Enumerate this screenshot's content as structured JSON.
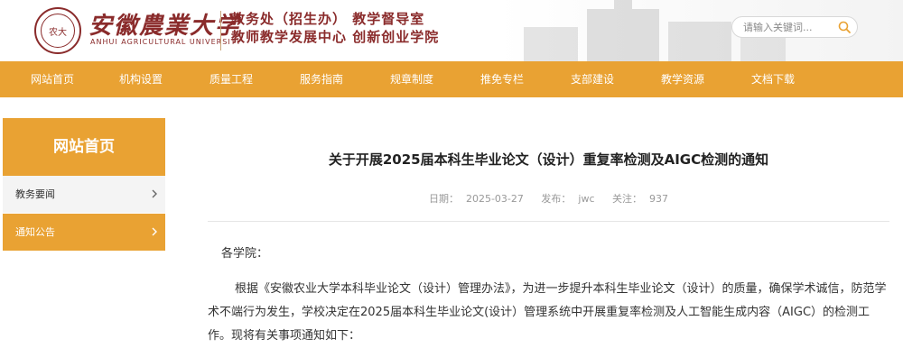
{
  "header": {
    "logo_text": "农大",
    "university_name": "安徽農業大学",
    "university_name_en": "ANHUI AGRICULTURAL UNIVERSITY",
    "dept_line1": "教务处（招生办） 教学督导室",
    "dept_line2": "教师教学发展中心 创新创业学院",
    "search_placeholder": "请输入关键词...",
    "search_icon": "search-icon"
  },
  "nav": {
    "items": [
      "网站首页",
      "机构设置",
      "质量工程",
      "服务指南",
      "规章制度",
      "推免专栏",
      "支部建设",
      "教学资源",
      "文档下载"
    ]
  },
  "sidebar": {
    "title": "网站首页",
    "items": [
      {
        "label": "教务要闻",
        "icon": "chevron-right-icon"
      },
      {
        "label": "通知公告",
        "icon": "chevron-right-icon"
      }
    ]
  },
  "article": {
    "title": "关于开展2025届本科生毕业论文（设计）重复率检测及AIGC检测的通知",
    "meta": {
      "date_label": "日期：",
      "date": "2025-03-27",
      "publisher_label": "发布：",
      "publisher": "jwc",
      "views_label": "关注：",
      "views": "937"
    },
    "salutation": "各学院：",
    "paragraph": "根据《安徽农业大学本科毕业论文（设计）管理办法》，为进一步提升本科生毕业论文（设计）的质量，确保学术诚信，防范学术不端行为发生，学校决定在2025届本科生毕业论文(设计）管理系统中开展重复率检测及人工智能生成内容（AIGC）的检测工作。现将有关事项通知如下："
  },
  "colors": {
    "accent": "#e9a233",
    "brand": "#8a2b2b"
  }
}
